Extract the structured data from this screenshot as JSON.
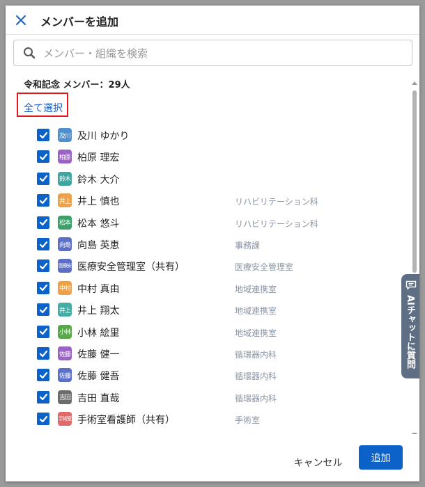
{
  "header": {
    "title": "メンバーを追加"
  },
  "search": {
    "placeholder": "メンバー・組織を検索"
  },
  "group": {
    "label": "令和記念 メンバー：29人",
    "select_all": "全て選択"
  },
  "members": [
    {
      "avatar": "及川",
      "name": "及川 ゆかり",
      "dept": "",
      "color": "#4f8fcf",
      "checked": true
    },
    {
      "avatar": "柏原",
      "name": "柏原 理宏",
      "dept": "",
      "color": "#9a62c4",
      "checked": true
    },
    {
      "avatar": "鈴木",
      "name": "鈴木 大介",
      "dept": "",
      "color": "#3fa5a0",
      "checked": true
    },
    {
      "avatar": "井上",
      "name": "井上 慎也",
      "dept": "リハビリテーション科",
      "color": "#eba049",
      "checked": true
    },
    {
      "avatar": "松本",
      "name": "松本 悠斗",
      "dept": "リハビリテーション科",
      "color": "#3f9f6a",
      "checked": true
    },
    {
      "avatar": "向島",
      "name": "向島 英恵",
      "dept": "事務課",
      "color": "#5b6fc7",
      "checked": true
    },
    {
      "avatar": "医療安",
      "name": "医療安全管理室（共有）",
      "dept": "医療安全管理室",
      "color": "#5b6fc7",
      "checked": true
    },
    {
      "avatar": "中村",
      "name": "中村 真由",
      "dept": "地域連携室",
      "color": "#eba049",
      "checked": true
    },
    {
      "avatar": "井上",
      "name": "井上 翔太",
      "dept": "地域連携室",
      "color": "#44aea5",
      "checked": true
    },
    {
      "avatar": "小林",
      "name": "小林 絵里",
      "dept": "地域連携室",
      "color": "#58a84b",
      "checked": true
    },
    {
      "avatar": "佐藤",
      "name": "佐藤 健一",
      "dept": "循環器内科",
      "color": "#9a62c4",
      "checked": true
    },
    {
      "avatar": "佐藤",
      "name": "佐藤 健吾",
      "dept": "循環器内科",
      "color": "#5b6fc7",
      "checked": true
    },
    {
      "avatar": "吉田",
      "name": "吉田 直哉",
      "dept": "循環器内科",
      "color": "#6c6c6c",
      "checked": true
    },
    {
      "avatar": "手術室",
      "name": "手術室看護師（共有）",
      "dept": "手術室",
      "color": "#e06a6a",
      "checked": true
    },
    {
      "avatar": "",
      "name": "",
      "dept": "",
      "color": "#9a62c4",
      "checked": true
    }
  ],
  "ai_chat": {
    "label": "AIチャットに質問"
  },
  "footer": {
    "cancel_label": "キャンセル",
    "add_label": "追加"
  },
  "colors": {
    "accent": "#0d62c9",
    "highlight_box": "#e8141c",
    "ai_tab": "#5e6e84"
  },
  "icons": {
    "close": "close-icon",
    "search": "search-icon",
    "check": "check-icon",
    "chat": "chat-bubble-icon"
  }
}
